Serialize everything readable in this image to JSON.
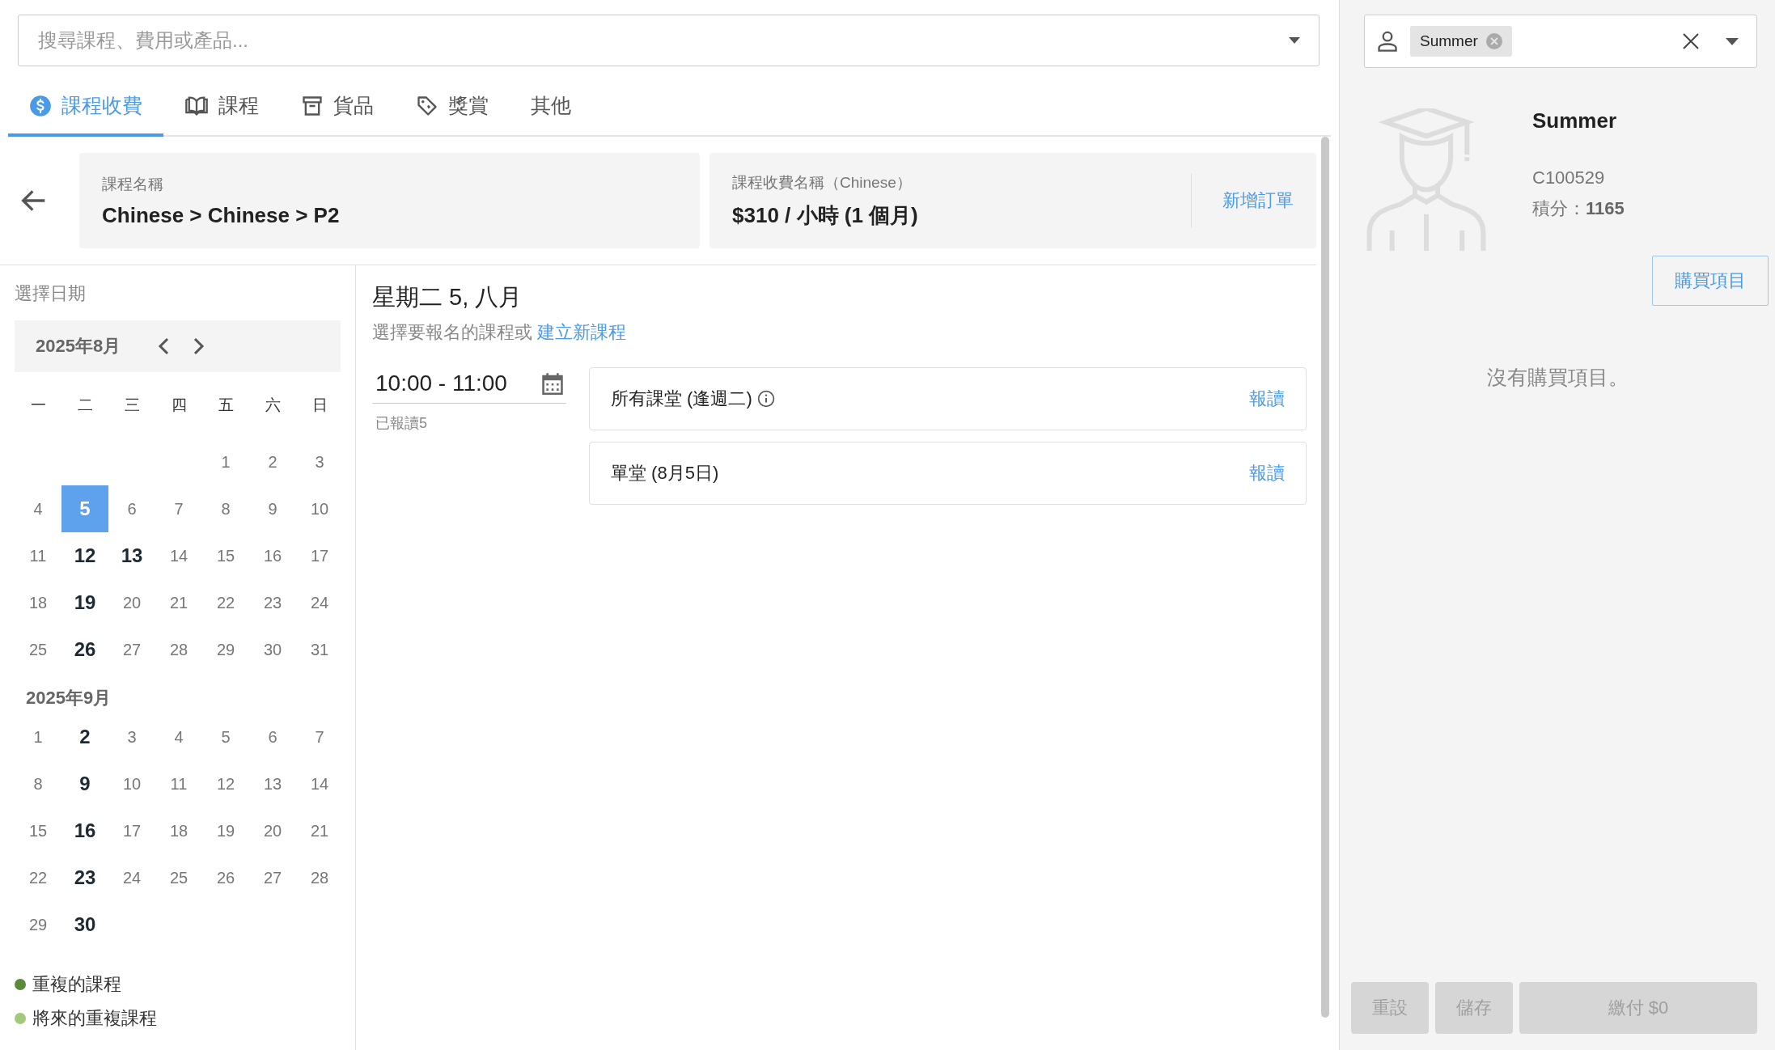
{
  "search": {
    "placeholder": "搜尋課程、費用或產品..."
  },
  "tabs": [
    {
      "label": "課程收費",
      "kind": "dollar",
      "selected": true
    },
    {
      "label": "課程",
      "kind": "book",
      "selected": false
    },
    {
      "label": "貨品",
      "kind": "box",
      "selected": false
    },
    {
      "label": "獎賞",
      "kind": "tag",
      "selected": false
    },
    {
      "label": "其他",
      "kind": "plain",
      "selected": false
    }
  ],
  "course_card": {
    "label": "課程名稱",
    "value": "Chinese > Chinese > P2"
  },
  "fee_card": {
    "label": "課程收費名稱（Chinese）",
    "value": "$310 / 小時 (1 個月)",
    "action": "新增訂單"
  },
  "calendar": {
    "title": "選擇日期",
    "weekdays": [
      "一",
      "二",
      "三",
      "四",
      "五",
      "六",
      "日"
    ],
    "months": [
      {
        "title": "2025年8月",
        "kind": "navigable",
        "weeks": [
          [
            {
              "label": "1",
              "has_class": false,
              "selected": false
            },
            {
              "label": "2",
              "has_class": false,
              "selected": false
            },
            {
              "label": "3",
              "has_class": false,
              "selected": false
            }
          ],
          [
            {
              "label": "4",
              "has_class": false,
              "selected": false
            },
            {
              "label": "5",
              "has_class": true,
              "selected": true
            },
            {
              "label": "6",
              "has_class": false,
              "selected": false
            },
            {
              "label": "7",
              "has_class": false,
              "selected": false
            },
            {
              "label": "8",
              "has_class": false,
              "selected": false
            },
            {
              "label": "9",
              "has_class": false,
              "selected": false
            },
            {
              "label": "10",
              "has_class": false,
              "selected": false
            }
          ],
          [
            {
              "label": "11",
              "has_class": false,
              "selected": false
            },
            {
              "label": "12",
              "has_class": true,
              "selected": false
            },
            {
              "label": "13",
              "has_class": true,
              "selected": false
            },
            {
              "label": "14",
              "has_class": false,
              "selected": false
            },
            {
              "label": "15",
              "has_class": false,
              "selected": false
            },
            {
              "label": "16",
              "has_class": false,
              "selected": false
            },
            {
              "label": "17",
              "has_class": false,
              "selected": false
            }
          ],
          [
            {
              "label": "18",
              "has_class": false,
              "selected": false
            },
            {
              "label": "19",
              "has_class": true,
              "selected": false
            },
            {
              "label": "20",
              "has_class": false,
              "selected": false
            },
            {
              "label": "21",
              "has_class": false,
              "selected": false
            },
            {
              "label": "22",
              "has_class": false,
              "selected": false
            },
            {
              "label": "23",
              "has_class": false,
              "selected": false
            },
            {
              "label": "24",
              "has_class": false,
              "selected": false
            }
          ],
          [
            {
              "label": "25",
              "has_class": false,
              "selected": false
            },
            {
              "label": "26",
              "has_class": true,
              "selected": false
            },
            {
              "label": "27",
              "has_class": false,
              "selected": false
            },
            {
              "label": "28",
              "has_class": false,
              "selected": false
            },
            {
              "label": "29",
              "has_class": false,
              "selected": false
            },
            {
              "label": "30",
              "has_class": false,
              "selected": false
            },
            {
              "label": "31",
              "has_class": false,
              "selected": false
            }
          ]
        ]
      },
      {
        "title": "2025年9月",
        "kind": "plain",
        "weeks": [
          [
            {
              "label": "1",
              "has_class": false,
              "selected": false
            },
            {
              "label": "2",
              "has_class": true,
              "selected": false
            },
            {
              "label": "3",
              "has_class": false,
              "selected": false
            },
            {
              "label": "4",
              "has_class": false,
              "selected": false
            },
            {
              "label": "5",
              "has_class": false,
              "selected": false
            },
            {
              "label": "6",
              "has_class": false,
              "selected": false
            },
            {
              "label": "7",
              "has_class": false,
              "selected": false
            }
          ],
          [
            {
              "label": "8",
              "has_class": false,
              "selected": false
            },
            {
              "label": "9",
              "has_class": true,
              "selected": false
            },
            {
              "label": "10",
              "has_class": false,
              "selected": false
            },
            {
              "label": "11",
              "has_class": false,
              "selected": false
            },
            {
              "label": "12",
              "has_class": false,
              "selected": false
            },
            {
              "label": "13",
              "has_class": false,
              "selected": false
            },
            {
              "label": "14",
              "has_class": false,
              "selected": false
            }
          ],
          [
            {
              "label": "15",
              "has_class": false,
              "selected": false
            },
            {
              "label": "16",
              "has_class": true,
              "selected": false
            },
            {
              "label": "17",
              "has_class": false,
              "selected": false
            },
            {
              "label": "18",
              "has_class": false,
              "selected": false
            },
            {
              "label": "19",
              "has_class": false,
              "selected": false
            },
            {
              "label": "20",
              "has_class": false,
              "selected": false
            },
            {
              "label": "21",
              "has_class": false,
              "selected": false
            }
          ],
          [
            {
              "label": "22",
              "has_class": false,
              "selected": false
            },
            {
              "label": "23",
              "has_class": true,
              "selected": false
            },
            {
              "label": "24",
              "has_class": false,
              "selected": false
            },
            {
              "label": "25",
              "has_class": false,
              "selected": false
            },
            {
              "label": "26",
              "has_class": false,
              "selected": false
            },
            {
              "label": "27",
              "has_class": false,
              "selected": false
            },
            {
              "label": "28",
              "has_class": false,
              "selected": false
            }
          ],
          [
            {
              "label": "29",
              "has_class": false,
              "selected": false
            },
            {
              "label": "30",
              "has_class": true,
              "selected": false
            }
          ]
        ]
      }
    ],
    "legend": [
      {
        "label": "重複的課程",
        "color": "#5b8a3a"
      },
      {
        "label": "將來的重複課程",
        "color": "#a3c97a"
      }
    ]
  },
  "day": {
    "title": "星期二 5, 八月",
    "hint": "選擇要報名的課程或",
    "link": "建立新課程",
    "time": "10:00 - 11:00",
    "enrolled": "已報讀5",
    "options": [
      {
        "name": "所有課堂 (逢週二)",
        "info": true,
        "action": "報讀"
      },
      {
        "name": "單堂 (8月5日)",
        "info": false,
        "action": "報讀"
      }
    ]
  },
  "customer": {
    "chip": "Summer",
    "name": "Summer",
    "id": "C100529",
    "points": "積分：**1165**",
    "purchase_button": "購買項目",
    "empty": "沒有購買項目。"
  },
  "footer": [
    {
      "label": "重設",
      "disabled": true
    },
    {
      "label": "儲存",
      "disabled": true
    },
    {
      "label": "繳付 $0",
      "disabled": true
    }
  ]
}
